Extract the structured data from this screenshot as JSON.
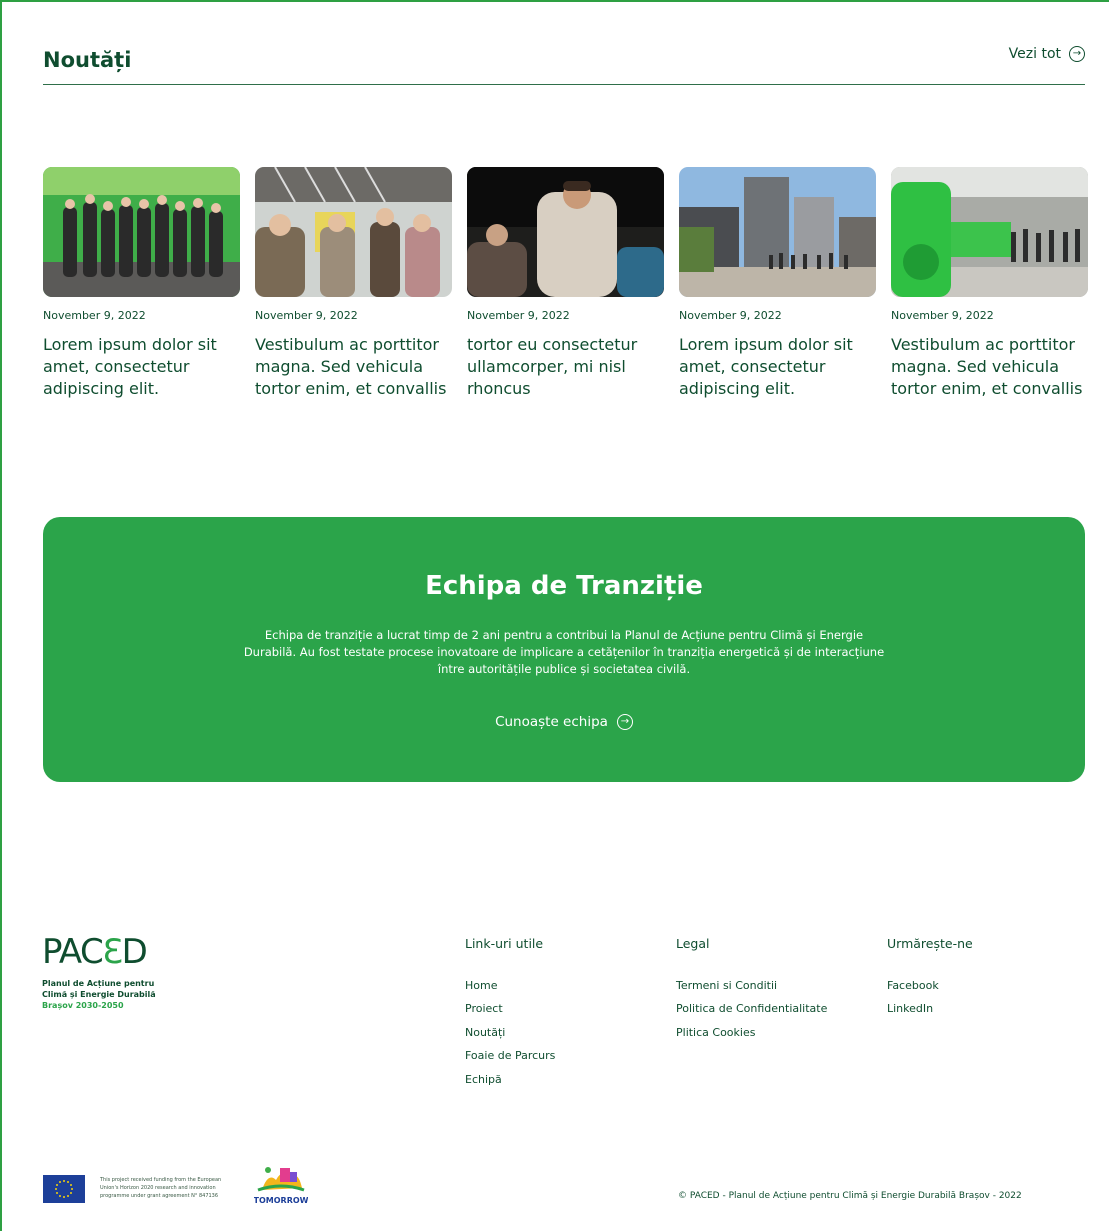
{
  "news": {
    "title": "Noutăți",
    "see_all": "Vezi tot",
    "items": [
      {
        "date": "November 9, 2022",
        "title": "Lorem ipsum dolor sit amet, consectetur adipiscing elit."
      },
      {
        "date": "November 9, 2022",
        "title": "Vestibulum ac porttitor magna. Sed vehicula tortor enim, et convallis"
      },
      {
        "date": "November 9, 2022",
        "title": "tortor eu consectetur ullamcorper, mi nisl rhoncus"
      },
      {
        "date": "November 9, 2022",
        "title": "Lorem ipsum dolor sit amet, consectetur adipiscing elit."
      },
      {
        "date": "November 9, 2022",
        "title": "Vestibulum ac porttitor magna. Sed vehicula tortor enim, et convallis"
      }
    ]
  },
  "team": {
    "title": "Echipa de Tranziție",
    "text": "Echipa de tranziție a lucrat timp de 2 ani pentru a contribui la Planul de Acțiune pentru Climă și Energie Durabilă. Au fost testate procese inovatoare de implicare a cetățenilor în tranziția energetică și de interacțiune între autoritățile publice și societatea civilă.",
    "link": "Cunoaște echipa"
  },
  "footer": {
    "logo": {
      "mark_a": "PAC",
      "mark_e": "Ɛ",
      "mark_b": "D",
      "line1": "Planul de Acțiune pentru",
      "line2": "Climă și Energie Durabilă",
      "line3": "Brașov 2030-2050"
    },
    "useful": {
      "title": "Link-uri utile",
      "items": [
        "Home",
        "Proiect",
        "Noutăți",
        "Foaie de Parcurs",
        "Echipă"
      ]
    },
    "legal": {
      "title": "Legal",
      "items": [
        "Termeni si Conditii",
        "Politica de Confidentialitate",
        "Plitica Cookies"
      ]
    },
    "follow": {
      "title": "Urmărește-ne",
      "items": [
        "Facebook",
        "LinkedIn"
      ]
    },
    "eu_text": "This project received funding from the European Union's Horizon 2020 research and innovation programme under grant agreement N° 847136",
    "tomorrow_label": "TOMORROW",
    "copyright": "© PACED - Planul de Acțiune pentru Climă și Energie Durabilă Brașov - 2022"
  },
  "colors": {
    "brand_green": "#2ba44a",
    "dark_green": "#0f4d2f"
  }
}
